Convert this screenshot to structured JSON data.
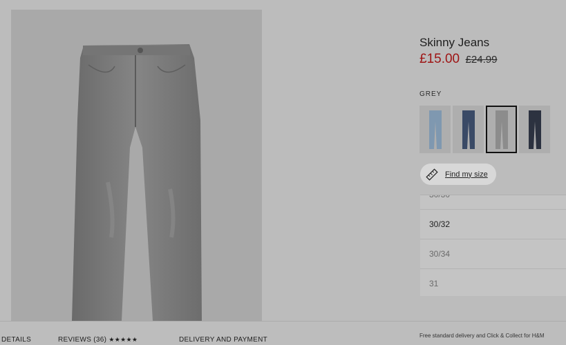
{
  "product": {
    "title": "Skinny Jeans",
    "price_now": "£15.00",
    "price_was": "£24.99",
    "color_label": "GREY",
    "swatches": [
      {
        "name": "light-blue",
        "color": "#7f98b0"
      },
      {
        "name": "dark-blue",
        "color": "#3a4a66"
      },
      {
        "name": "grey",
        "color": "#8c8c8c"
      },
      {
        "name": "black-blue",
        "color": "#2c3240"
      }
    ],
    "selected_swatch": 2,
    "find_size_label": "Find my size"
  },
  "sizes": {
    "items": [
      {
        "label": "30/30",
        "available": false
      },
      {
        "label": "30/32",
        "available": true
      },
      {
        "label": "30/34",
        "available": false
      },
      {
        "label": "31",
        "available": false
      }
    ]
  },
  "tabs": {
    "details": "DETAILS",
    "reviews": "REVIEWS (36)",
    "rating_stars": "★★★★★",
    "delivery": "DELIVERY AND PAYMENT"
  },
  "delivery": {
    "line1": "Free standard delivery and Click & Collect for H&M"
  },
  "colors": {
    "sale_red": "#9e1414",
    "overlay_grey": "#bcbcbc"
  }
}
